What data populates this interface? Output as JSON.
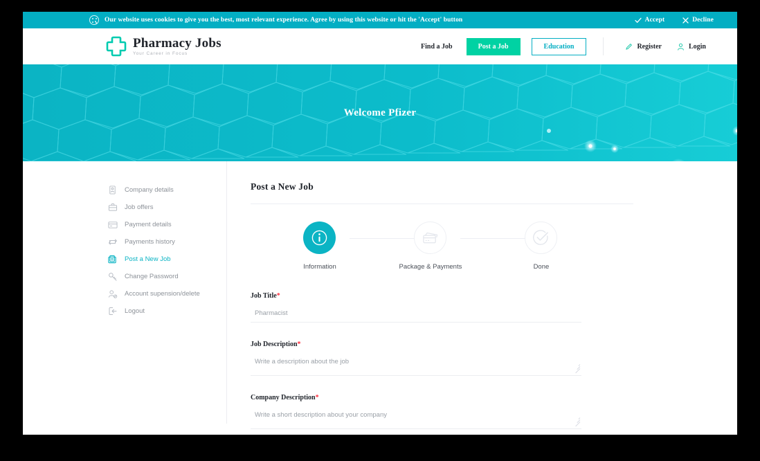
{
  "cookie": {
    "icon": "cookie-icon",
    "message": "Our website uses cookies to give you the best, most relevant experience. Agree by using this website or hit the 'Accept' button",
    "accept_label": "Accept",
    "decline_label": "Decline"
  },
  "brand": {
    "name": "Pharmacy Jobs",
    "tagline": "Your Career in Focus",
    "logo_icon": "medical-cross-icon"
  },
  "nav": {
    "find_job": "Find a Job",
    "post_job": "Post a Job",
    "education": "Education",
    "register": "Register",
    "login": "Login",
    "register_icon": "pencil-icon",
    "login_icon": "user-icon"
  },
  "hero": {
    "title": "Welcome Pfizer"
  },
  "sidebar": {
    "items": [
      {
        "label": "Company details",
        "icon": "id-card-icon",
        "active": false
      },
      {
        "label": "Job offers",
        "icon": "briefcase-icon",
        "active": false
      },
      {
        "label": "Payment details",
        "icon": "credit-card-icon",
        "active": false
      },
      {
        "label": "Payments history",
        "icon": "refresh-icon",
        "active": false
      },
      {
        "label": "Post a New Job",
        "icon": "new-job-icon",
        "active": true
      },
      {
        "label": "Change Password",
        "icon": "key-icon",
        "active": false
      },
      {
        "label": "Account supension/delete",
        "icon": "user-remove-icon",
        "active": false
      },
      {
        "label": "Logout",
        "icon": "logout-icon",
        "active": false
      }
    ]
  },
  "main": {
    "title": "Post a New Job",
    "steps": [
      {
        "label": "Information",
        "icon": "info-icon",
        "state": "active"
      },
      {
        "label": "Package & Payments",
        "icon": "card-payment-icon",
        "state": "upcoming"
      },
      {
        "label": "Done",
        "icon": "check-circle-icon",
        "state": "upcoming"
      }
    ],
    "fields": {
      "job_title": {
        "label": "Job Title",
        "required": "*",
        "value": "",
        "placeholder": "Pharmacist"
      },
      "job_description": {
        "label": "Job Description",
        "required": "*",
        "value": "",
        "placeholder": "Write a description about the job"
      },
      "company_description": {
        "label": "Company Description",
        "required": "*",
        "value": "",
        "placeholder": "Write a short description about your company"
      }
    }
  },
  "colors": {
    "cookie_bar": "#03aec3",
    "hero": "#0db9c8",
    "accent": "#0bb4c4",
    "post_job_button": "#00d2a3",
    "required": "#ff2d3d"
  }
}
